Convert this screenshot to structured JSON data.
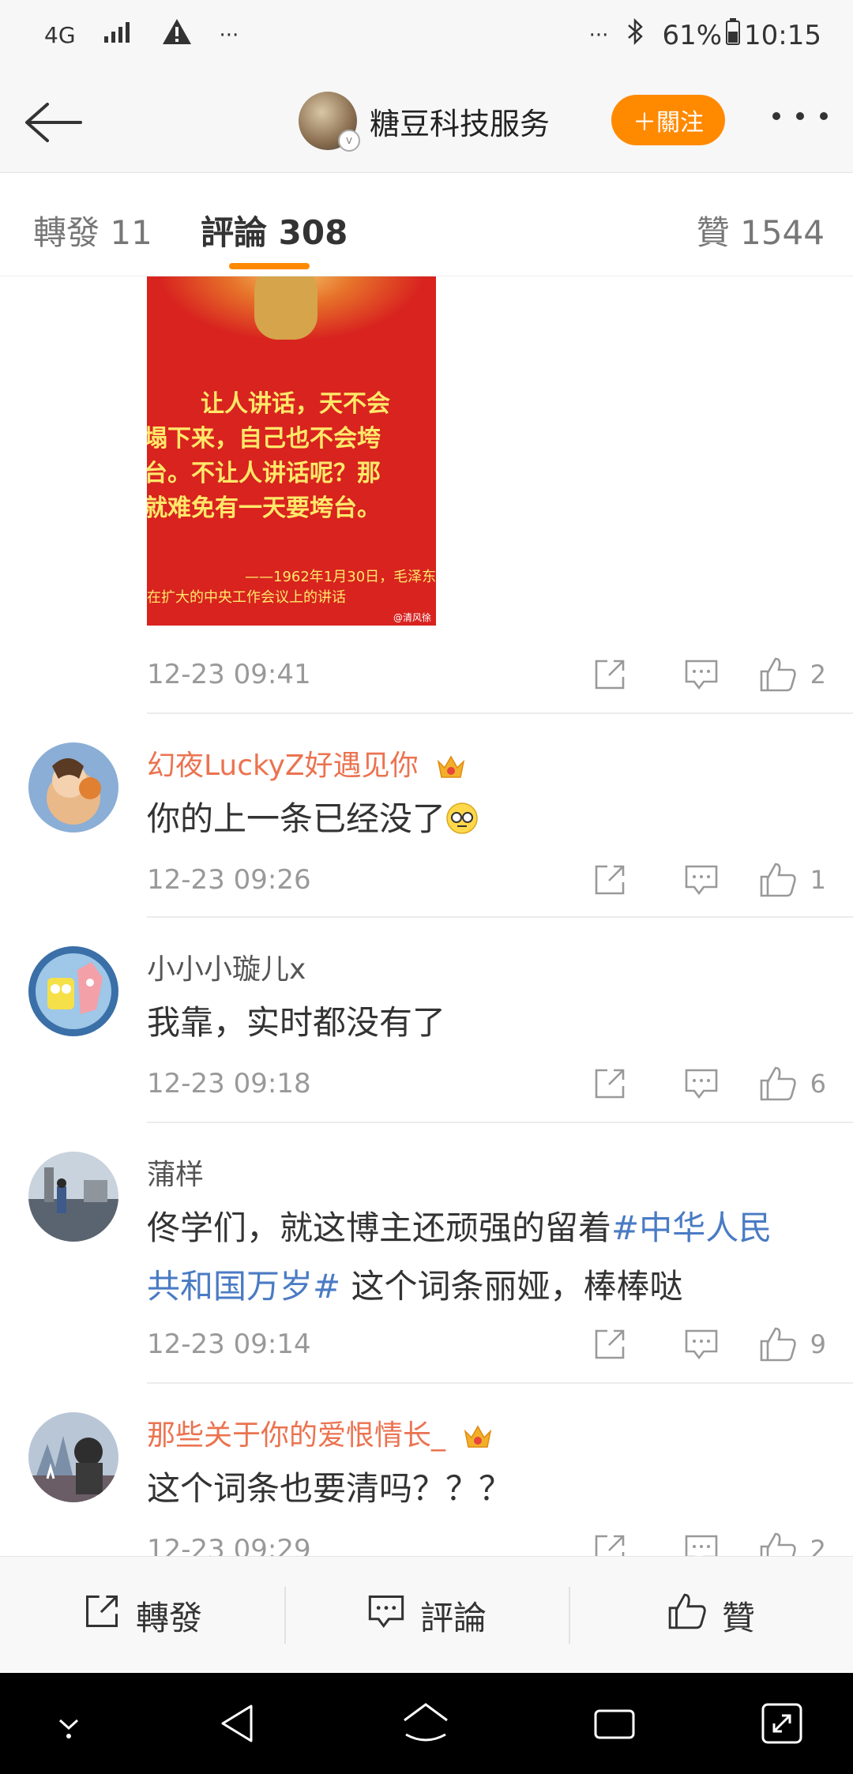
{
  "status_bar": {
    "network": "4G",
    "extra": "···",
    "right_dots": "···",
    "battery": "61%",
    "time": "10:15"
  },
  "header": {
    "title": "糖豆科技服务",
    "follow_label": "＋關注"
  },
  "tabs": [
    {
      "label": "轉發 11"
    },
    {
      "label": "評論 308"
    },
    {
      "label": "贊 1544"
    }
  ],
  "poster": {
    "lines": [
      "让人讲话，天不会",
      "塌下来，自己也不会垮",
      "台。不让人讲话呢？那",
      "就难免有一天要垮台。"
    ],
    "signature_line1": "——1962年1月30日，毛泽东",
    "signature_line2": "在扩大的中央工作会议上的讲话",
    "watermark": "@清风徐"
  },
  "first_meta": {
    "time": "12-23 09:41",
    "likes": "2"
  },
  "comments": [
    {
      "name": "幻夜LuckyZ好遇见你",
      "vip": true,
      "text": "你的上一条已经没了",
      "time": "12-23 09:26",
      "likes": "1"
    },
    {
      "name": "小小小璇儿x",
      "vip": false,
      "text": "我靠，实时都没有了",
      "time": "12-23 09:18",
      "likes": "6"
    },
    {
      "name": "蒲样",
      "vip": false,
      "text_before": "佟学们，就这博主还顽强的留着",
      "topic_part1": "#中华人民",
      "topic_part2": "共和国万岁#",
      "text_after": " 这个词条丽娅，棒棒哒",
      "time": "12-23 09:14",
      "likes": "9"
    },
    {
      "name": "那些关于你的爱恨情长_",
      "vip": true,
      "text": "这个词条也要清吗？？？",
      "time": "12-23 09:29",
      "likes": "2"
    }
  ],
  "bottom_bar": {
    "repost": "轉發",
    "comment": "評論",
    "like": "贊"
  },
  "colors": {
    "accent": "#ff8a00",
    "username_vip": "#eb7350",
    "topic": "#4a7bc4"
  }
}
